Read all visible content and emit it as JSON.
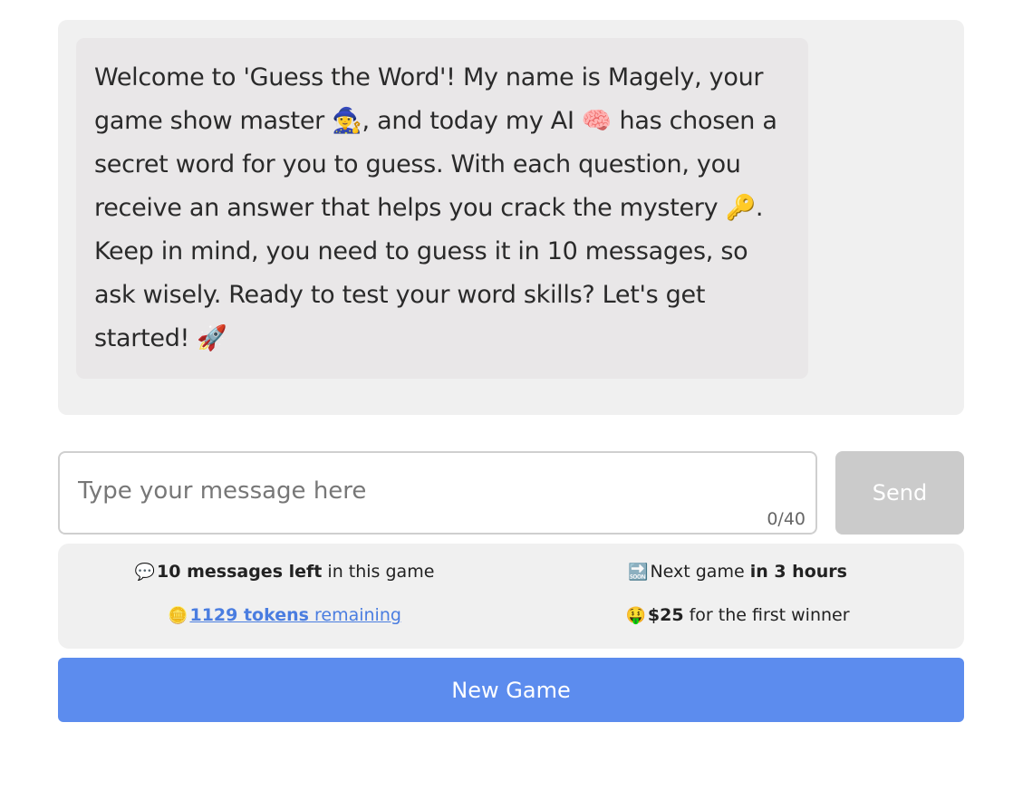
{
  "chat": {
    "assistant_message": "Welcome to 'Guess the Word'! My name is Magely, your game show master 🧙‍♀️, and today my AI 🧠 has chosen a secret word for you to guess. With each question, you receive an answer that helps you crack the mystery 🔑. Keep in mind, you need to guess it in 10 messages, so ask wisely. Ready to test your word skills? Let's get started! 🚀"
  },
  "composer": {
    "placeholder": "Type your message here",
    "value": "",
    "char_count": "0/40",
    "send_label": "Send"
  },
  "stats": {
    "messages": {
      "icon": "💬",
      "icon_name": "speech-bubble-icon",
      "bold": "10 messages left",
      "rest": " in this game"
    },
    "next_game": {
      "icon": "🔜",
      "icon_name": "soon-arrow-icon",
      "prefix": "Next game ",
      "bold": "in 3 hours"
    },
    "tokens": {
      "icon": "🪙",
      "icon_name": "coin-icon",
      "bold": "1129 tokens",
      "rest": " remaining"
    },
    "prize": {
      "icon": "🤑",
      "icon_name": "money-mouth-face-icon",
      "bold": "$25",
      "rest": " for the first winner"
    }
  },
  "actions": {
    "new_game_label": "New Game"
  },
  "colors": {
    "accent": "#5c8cee",
    "link": "#4a7de0",
    "send_disabled": "#cbcbcb",
    "panel": "#f0f0f0"
  }
}
